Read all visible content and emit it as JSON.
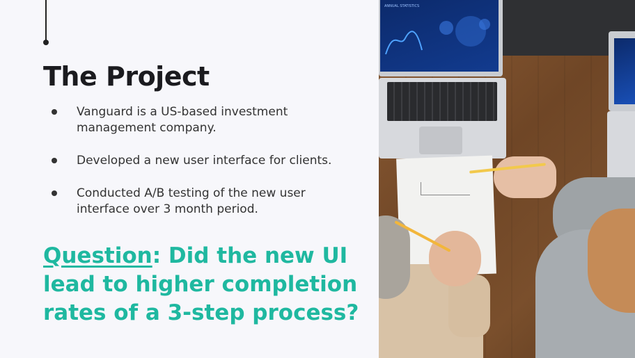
{
  "slide": {
    "title": "The Project",
    "bullets": [
      {
        "text": "Vanguard is a US-based investment management company."
      },
      {
        "text": "Developed a new user interface for clients."
      },
      {
        "text": "Conducted A/B testing of the new user interface over 3 month period."
      }
    ],
    "question": {
      "label": "Question",
      "text": ": Did the new UI lead to higher completion rates of a 3-step process?"
    }
  },
  "photo": {
    "screen_title": "ANNUAL STATISTICS"
  },
  "colors": {
    "accent": "#1fb8a0",
    "title": "#1b1b1f",
    "body": "#333333",
    "background": "#f7f7fb"
  }
}
